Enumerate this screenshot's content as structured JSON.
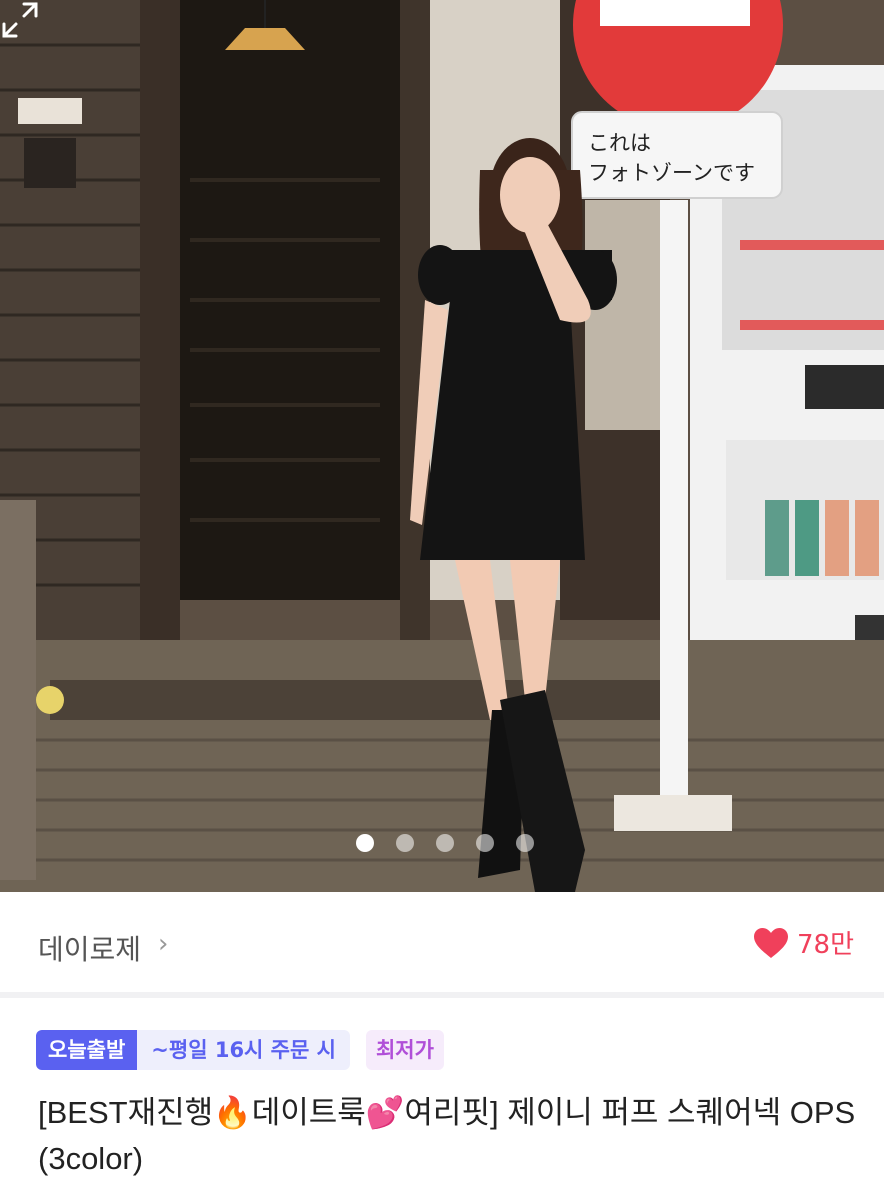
{
  "product_image": {
    "sign_text": "これは\nフォトゾーンです",
    "sign_text_line1": "これは",
    "sign_text_line2": "フォトゾーンです",
    "carousel_count": 5,
    "carousel_active": 0
  },
  "shop": {
    "name": "데이로제",
    "chevron": "›"
  },
  "like": {
    "icon": "heart-icon",
    "count": "78만",
    "color": "#f0405b"
  },
  "tags": {
    "delivery": "오늘출발",
    "delivery_condition": "~평일 16시 주문 시",
    "lowest_price": "최저가"
  },
  "product": {
    "title": "[BEST재진행🔥데이트룩💕여리핏] 제이니 퍼프 스퀘어넥 OPS (3color)"
  },
  "colors": {
    "accent": "#5a61f0",
    "price_tag": "#b04fd8",
    "like": "#f0405b"
  }
}
